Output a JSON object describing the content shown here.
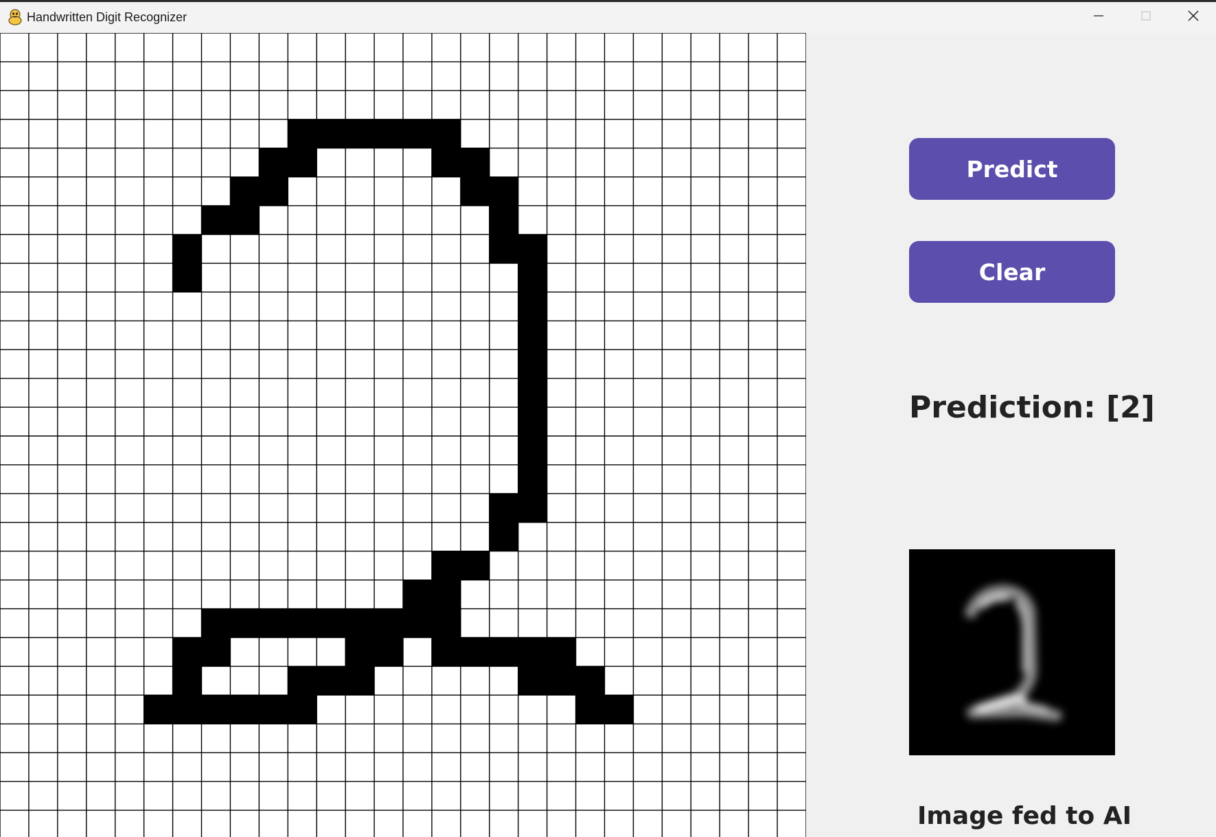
{
  "window": {
    "title": "Handwritten Digit Recognizer",
    "controls": [
      "minimize",
      "maximize",
      "close"
    ]
  },
  "icons": {
    "app": "python-icon",
    "minimize": "minimize-icon",
    "maximize": "maximize-icon",
    "close": "close-icon"
  },
  "drawing_grid": {
    "rows": 28,
    "cols": 28,
    "filled_color": "#000000",
    "empty_color": "#ffffff",
    "line_color": "#000000",
    "pixels": [
      "............................",
      "............................",
      "............................",
      "..........######............",
      ".........##....##...........",
      "........##......##..........",
      ".......##........#..........",
      "......#..........##.........",
      "......#...........#.........",
      "..................#.........",
      "..................#.........",
      "..................#.........",
      "..................#.........",
      "..................#.........",
      "..................#.........",
      "..................#.........",
      ".................##.........",
      ".................#..........",
      "...............##...........",
      "..............##............",
      ".......#########............",
      "......##....##.#####........",
      "......#...###.....###.......",
      ".....######.........##......",
      "............................",
      "............................",
      "............................",
      "............................"
    ]
  },
  "panel": {
    "predict_label": "Predict",
    "clear_label": "Clear",
    "prediction_text": "Prediction: [2]",
    "preview_caption": "Image fed to AI"
  },
  "colors": {
    "button": "#5b4eac",
    "button_text": "#ffffff",
    "panel_background": "#f0f0f0",
    "text": "#222222"
  }
}
